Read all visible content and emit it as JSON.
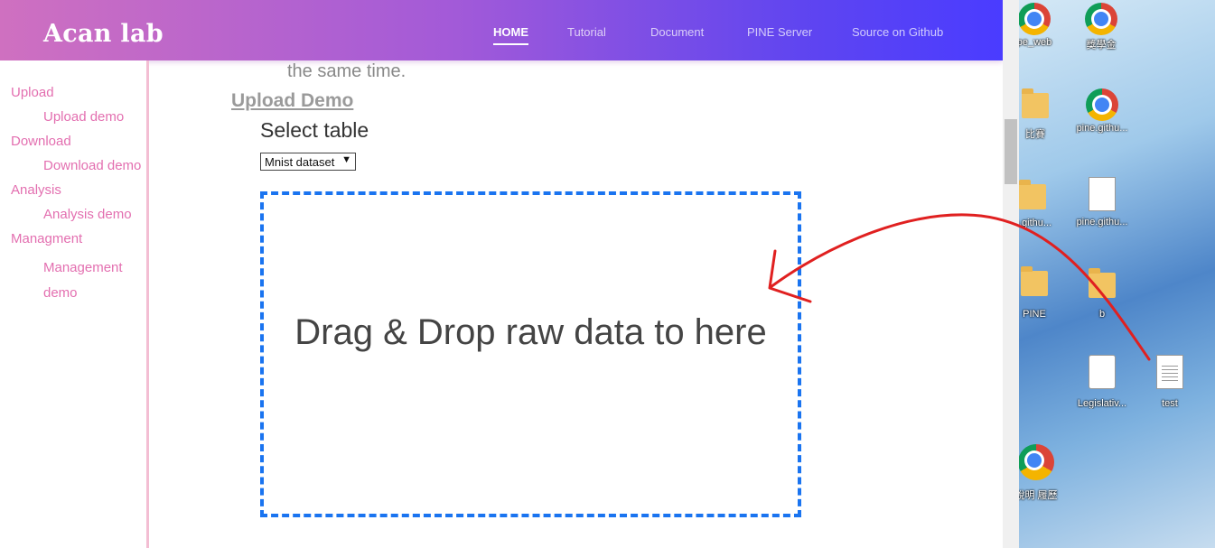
{
  "brand": "Acan lab",
  "nav": {
    "items": [
      {
        "label": "HOME",
        "active": true
      },
      {
        "label": "Tutorial",
        "active": false
      },
      {
        "label": "Document",
        "active": false
      },
      {
        "label": "PINE Server",
        "active": false
      },
      {
        "label": "Source on Github",
        "active": false
      }
    ]
  },
  "sidebar": {
    "items": [
      {
        "label": "Upload",
        "level": 1
      },
      {
        "label": "Upload demo",
        "level": 2
      },
      {
        "label": "Download",
        "level": 1
      },
      {
        "label": "Download demo",
        "level": 2
      },
      {
        "label": "Analysis",
        "level": 1
      },
      {
        "label": "Analysis demo",
        "level": 2
      },
      {
        "label": "Managment",
        "level": 1
      },
      {
        "label": "Management demo",
        "level": 2
      }
    ]
  },
  "main": {
    "cut_off_text": "the same time.",
    "section_title": "Upload Demo",
    "select_label": "Select table",
    "select_value": "Mnist dataset",
    "dropzone_text": "Drag & Drop raw data to here"
  },
  "desktop": {
    "icons": [
      {
        "label": "pe_web",
        "icon": "chrome-shortcut-icon"
      },
      {
        "label": "獎學金",
        "icon": "chrome-shortcut-icon"
      },
      {
        "label": "比賽",
        "icon": "folder-icon"
      },
      {
        "label": "pine.githu...",
        "icon": "chrome-shortcut-icon"
      },
      {
        "label": "e.githu...",
        "icon": "folder-icon"
      },
      {
        "label": "pine.githu...",
        "icon": "document-icon"
      },
      {
        "label": "PINE",
        "icon": "zip-folder-icon"
      },
      {
        "label": "b",
        "icon": "folder-icon"
      },
      {
        "label": "Legislativ...",
        "icon": "paint-file-icon"
      },
      {
        "label": "test",
        "icon": "text-file-icon"
      },
      {
        "label": "說明 履歷",
        "icon": "chrome-shortcut-icon"
      }
    ]
  },
  "colors": {
    "nav_gradient_start": "#cf70c0",
    "nav_gradient_end": "#4a3cff",
    "sidebar_link": "#e36fb0",
    "dropzone_border": "#1a74f0",
    "annotation_arrow": "#e02020"
  }
}
